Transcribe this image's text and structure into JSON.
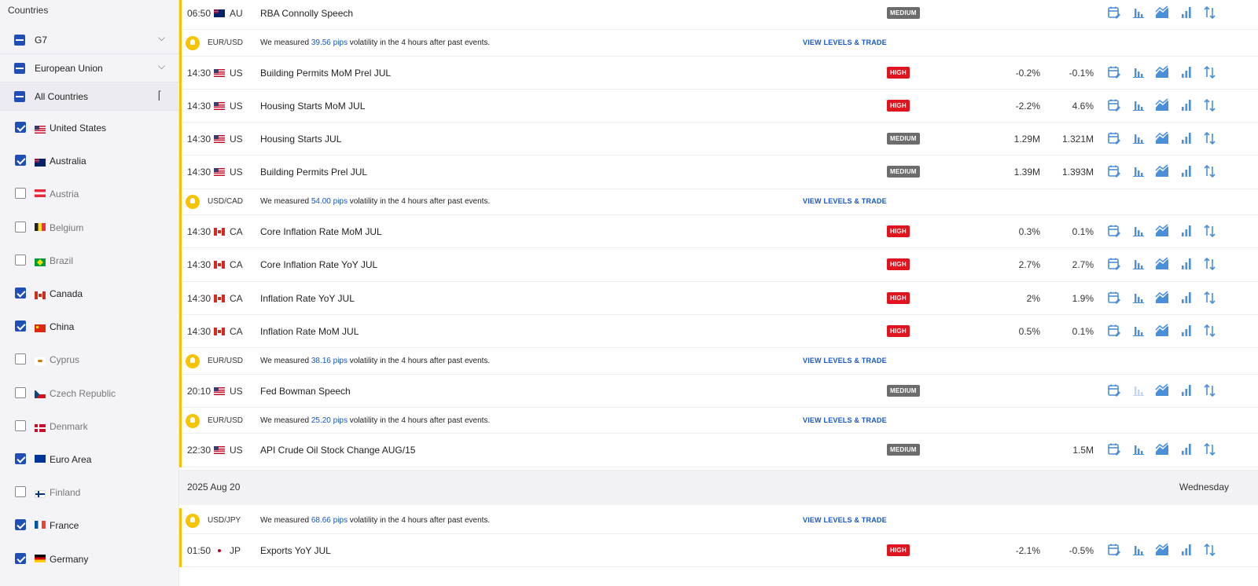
{
  "sidebar": {
    "title": "Countries",
    "groups": [
      {
        "label": "G7"
      },
      {
        "label": "European Union"
      },
      {
        "label": "All Countries"
      }
    ],
    "countries": [
      {
        "label": "United States",
        "flag": "US",
        "checked": true
      },
      {
        "label": "Australia",
        "flag": "AU",
        "checked": true
      },
      {
        "label": "Austria",
        "flag": "AT",
        "checked": false
      },
      {
        "label": "Belgium",
        "flag": "BE",
        "checked": false
      },
      {
        "label": "Brazil",
        "flag": "BR",
        "checked": false
      },
      {
        "label": "Canada",
        "flag": "CA",
        "checked": true
      },
      {
        "label": "China",
        "flag": "CN",
        "checked": true
      },
      {
        "label": "Cyprus",
        "flag": "CY",
        "checked": false
      },
      {
        "label": "Czech Republic",
        "flag": "CZ",
        "checked": false
      },
      {
        "label": "Denmark",
        "flag": "DK",
        "checked": false
      },
      {
        "label": "Euro Area",
        "flag": "EU",
        "checked": true
      },
      {
        "label": "Finland",
        "flag": "FI",
        "checked": false
      },
      {
        "label": "France",
        "flag": "FR",
        "checked": true
      },
      {
        "label": "Germany",
        "flag": "DE",
        "checked": true
      }
    ]
  },
  "calendar": {
    "insight_text_pre": "We measured",
    "insight_text_post": "volatility in the 4 hours after past events.",
    "view_link": "VIEW LEVELS & TRADE",
    "rows": [
      {
        "type": "event",
        "time": "06:50",
        "cc": "AU",
        "flag": "AU",
        "name": "RBA Connolly Speech",
        "importance": "MEDIUM",
        "v1": "",
        "v2": "",
        "chart_disabled": false
      },
      {
        "type": "insight",
        "pair": "EUR/USD",
        "pips": "39.56 pips"
      },
      {
        "type": "event",
        "time": "14:30",
        "cc": "US",
        "flag": "US",
        "name": "Building Permits MoM Prel JUL",
        "importance": "HIGH",
        "v1": "-0.2%",
        "v2": "-0.1%",
        "chart_disabled": false
      },
      {
        "type": "event",
        "time": "14:30",
        "cc": "US",
        "flag": "US",
        "name": "Housing Starts MoM JUL",
        "importance": "HIGH",
        "v1": "-2.2%",
        "v2": "4.6%",
        "chart_disabled": false
      },
      {
        "type": "event",
        "time": "14:30",
        "cc": "US",
        "flag": "US",
        "name": "Housing Starts JUL",
        "importance": "MEDIUM",
        "v1": "1.29M",
        "v2": "1.321M",
        "chart_disabled": false
      },
      {
        "type": "event",
        "time": "14:30",
        "cc": "US",
        "flag": "US",
        "name": "Building Permits Prel JUL",
        "importance": "MEDIUM",
        "v1": "1.39M",
        "v2": "1.393M",
        "chart_disabled": false
      },
      {
        "type": "insight",
        "pair": "USD/CAD",
        "pips": "54.00 pips"
      },
      {
        "type": "event",
        "time": "14:30",
        "cc": "CA",
        "flag": "CA",
        "name": "Core Inflation Rate MoM JUL",
        "importance": "HIGH",
        "v1": "0.3%",
        "v2": "0.1%",
        "chart_disabled": false
      },
      {
        "type": "event",
        "time": "14:30",
        "cc": "CA",
        "flag": "CA",
        "name": "Core Inflation Rate YoY JUL",
        "importance": "HIGH",
        "v1": "2.7%",
        "v2": "2.7%",
        "chart_disabled": false
      },
      {
        "type": "event",
        "time": "14:30",
        "cc": "CA",
        "flag": "CA",
        "name": "Inflation Rate YoY JUL",
        "importance": "HIGH",
        "v1": "2%",
        "v2": "1.9%",
        "chart_disabled": false
      },
      {
        "type": "event",
        "time": "14:30",
        "cc": "CA",
        "flag": "CA",
        "name": "Inflation Rate MoM JUL",
        "importance": "HIGH",
        "v1": "0.5%",
        "v2": "0.1%",
        "chart_disabled": false
      },
      {
        "type": "insight",
        "pair": "EUR/USD",
        "pips": "38.16 pips"
      },
      {
        "type": "event",
        "time": "20:10",
        "cc": "US",
        "flag": "US",
        "name": "Fed Bowman Speech",
        "importance": "MEDIUM",
        "v1": "",
        "v2": "",
        "chart_disabled": true
      },
      {
        "type": "insight",
        "pair": "EUR/USD",
        "pips": "25.20 pips"
      },
      {
        "type": "event",
        "time": "22:30",
        "cc": "US",
        "flag": "US",
        "name": "API Crude Oil Stock Change AUG/15",
        "importance": "MEDIUM",
        "v1": "",
        "v2": "1.5M",
        "chart_disabled": false
      },
      {
        "type": "date",
        "date": "2025 Aug 20",
        "dow": "Wednesday"
      },
      {
        "type": "insight",
        "pair": "USD/JPY",
        "pips": "68.66 pips"
      },
      {
        "type": "event",
        "time": "01:50",
        "cc": "JP",
        "flag": "JP",
        "name": "Exports YoY JUL",
        "importance": "HIGH",
        "v1": "-2.1%",
        "v2": "-0.5%",
        "chart_disabled": false
      }
    ]
  },
  "icons": [
    "calendar-icon",
    "bar-chart-icon",
    "area-chart-icon",
    "column-chart-icon",
    "sort-arrows-icon"
  ],
  "colors": {
    "accent_blue": "#1f4fb5",
    "link_blue": "#1a56c4",
    "icon_blue": "#4a8fd8",
    "high": "#e0141f",
    "medium": "#6c6c6c",
    "highlight_yellow": "#f6c300"
  }
}
